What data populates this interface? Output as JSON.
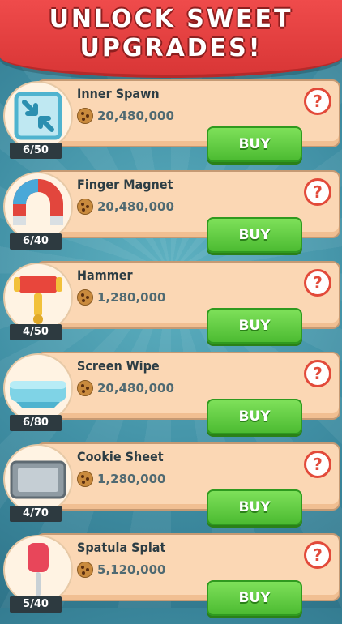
{
  "banner": {
    "line1": "UNLOCK SWEET",
    "line2": "UPGRADES!"
  },
  "colors": {
    "banner": "#ef4b4b",
    "panel": "#fbd7b4",
    "buy": "#4cbb32",
    "help": "#e24a3a",
    "background": "#3f8ea3"
  },
  "upgrades": [
    {
      "name": "Inner Spawn",
      "price": "20,480,000",
      "level": "6/50",
      "buy_label": "BUY",
      "help_label": "?",
      "icon": "inner-spawn-icon"
    },
    {
      "name": "Finger Magnet",
      "price": "20,480,000",
      "level": "6/40",
      "buy_label": "BUY",
      "help_label": "?",
      "icon": "magnet-icon"
    },
    {
      "name": "Hammer",
      "price": "1,280,000",
      "level": "4/50",
      "buy_label": "BUY",
      "help_label": "?",
      "icon": "hammer-icon"
    },
    {
      "name": "Screen Wipe",
      "price": "20,480,000",
      "level": "6/80",
      "buy_label": "BUY",
      "help_label": "?",
      "icon": "screen-wipe-icon"
    },
    {
      "name": "Cookie Sheet",
      "price": "1,280,000",
      "level": "4/70",
      "buy_label": "BUY",
      "help_label": "?",
      "icon": "cookie-sheet-icon"
    },
    {
      "name": "Spatula Splat",
      "price": "5,120,000",
      "level": "5/40",
      "buy_label": "BUY",
      "help_label": "?",
      "icon": "spatula-icon"
    }
  ]
}
